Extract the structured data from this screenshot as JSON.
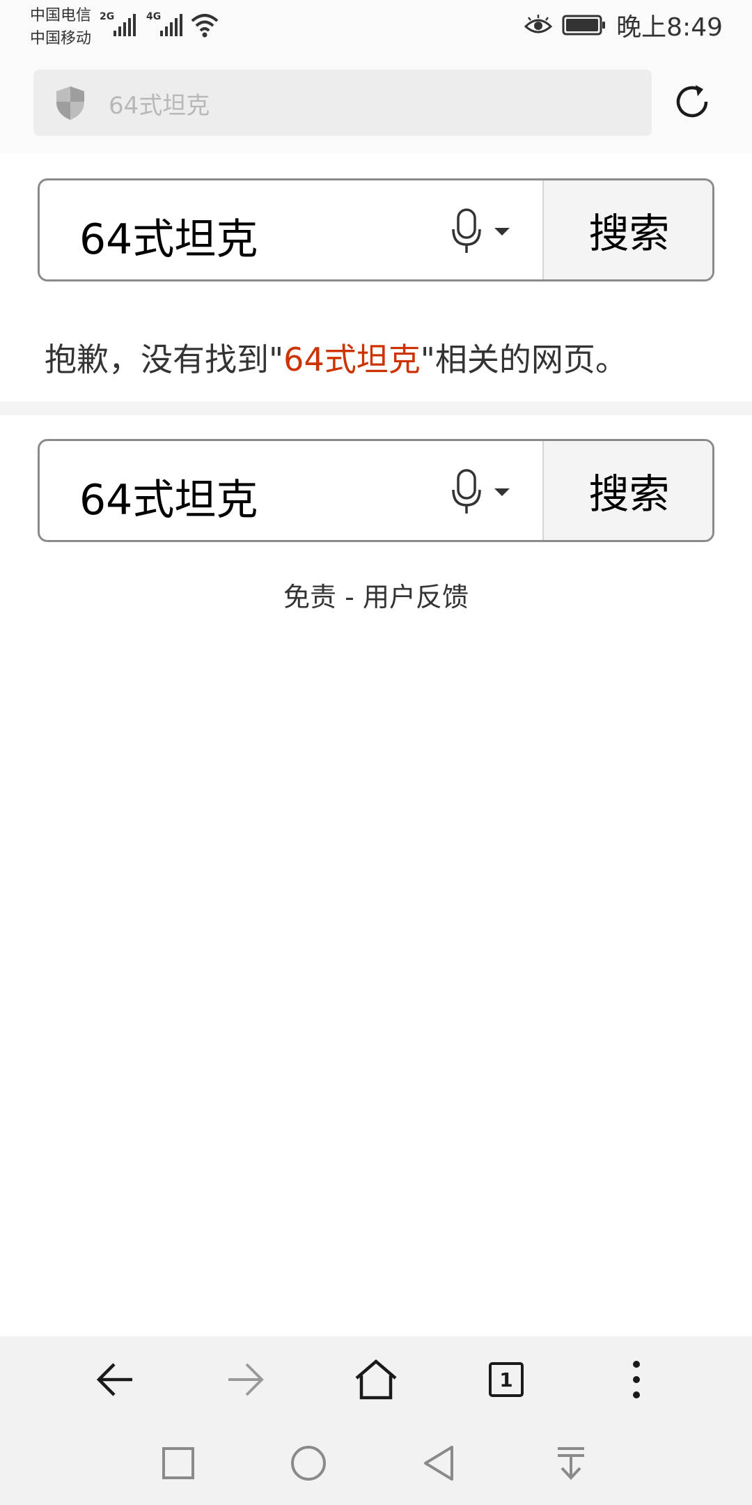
{
  "status_bar": {
    "carrier_1": "中国电信",
    "carrier_2": "中国移动",
    "network_1": "2G",
    "network_2": "4G",
    "time": "晚上8:49"
  },
  "address_bar": {
    "text": "64式坦克"
  },
  "search_top": {
    "query": "64式坦克",
    "button_label": "搜索"
  },
  "no_result": {
    "prefix": "抱歉，没有找到\"",
    "query": "64式坦克",
    "suffix": "\"相关的网页。"
  },
  "search_bottom": {
    "query": "64式坦克",
    "button_label": "搜索"
  },
  "footer": {
    "disclaimer": "免责",
    "separator": "-",
    "feedback": "用户反馈"
  },
  "toolbar": {
    "tab_count": "1"
  },
  "colors": {
    "highlight": "#cc3300",
    "toolbar_bg": "#f2f2f2"
  }
}
